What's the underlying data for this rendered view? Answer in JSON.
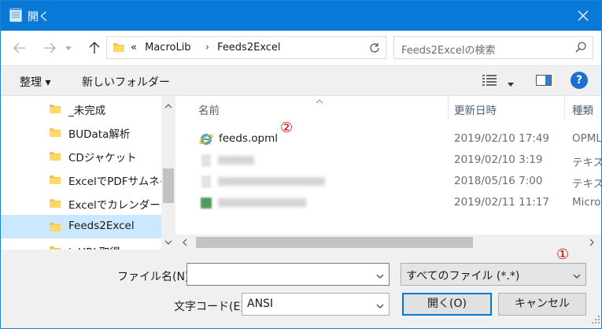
{
  "window": {
    "title": "開く",
    "accent": "#0a78d7"
  },
  "nav": {
    "breadcrumb_overflow": "«",
    "breadcrumbs": [
      "MacroLib",
      "Feeds2Excel"
    ],
    "search_placeholder": "Feeds2Excelの検索"
  },
  "toolbar": {
    "organize_label": "整理 ▾",
    "new_folder_label": "新しいフォルダー",
    "help_label": "?"
  },
  "tree": {
    "items": [
      {
        "label": "_未完成"
      },
      {
        "label": "BUData解析"
      },
      {
        "label": "CDジャケット"
      },
      {
        "label": "ExcelでPDFサムネイ"
      },
      {
        "label": "Excelでカレンダー"
      },
      {
        "label": "Feeds2Excel",
        "selected": true
      },
      {
        "label": "ieURL取得"
      }
    ]
  },
  "list": {
    "columns": [
      "名前",
      "更新日時",
      "種類"
    ],
    "rows": [
      {
        "name": "feeds.opml",
        "date": "2019/02/10 17:49",
        "type": "OPML",
        "icon": "ie-file-icon"
      },
      {
        "name": "",
        "date": "2019/02/10 3:19",
        "type": "テキスト",
        "icon": "text-file-icon"
      },
      {
        "name": "",
        "date": "2018/05/16 7:00",
        "type": "テキスト",
        "icon": "text-file-icon"
      },
      {
        "name": "",
        "date": "2019/02/11 11:17",
        "type": "Micro",
        "icon": "excel-file-icon"
      }
    ]
  },
  "annotations": {
    "one": "①",
    "two": "②"
  },
  "bottom": {
    "filename_label": "ファイル名(N):",
    "filename_value": "",
    "filetype_value": "すべてのファイル (*.*)",
    "encoding_label": "文字コード(E):",
    "encoding_value": "ANSI",
    "open_label": "開く(O)",
    "cancel_label": "キャンセル"
  }
}
